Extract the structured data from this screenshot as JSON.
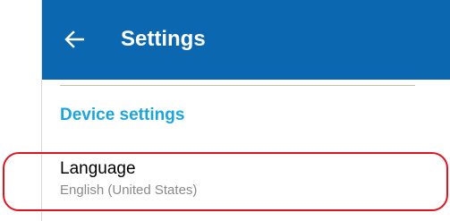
{
  "appbar": {
    "title": "Settings",
    "background_color": "#0a67b0",
    "back_icon": "arrow-left-icon"
  },
  "section": {
    "header": "Device settings",
    "color": "#1aa6dc"
  },
  "items": [
    {
      "label": "Language",
      "value": "English (United States)"
    }
  ],
  "annotation": {
    "color": "#e0141e"
  }
}
